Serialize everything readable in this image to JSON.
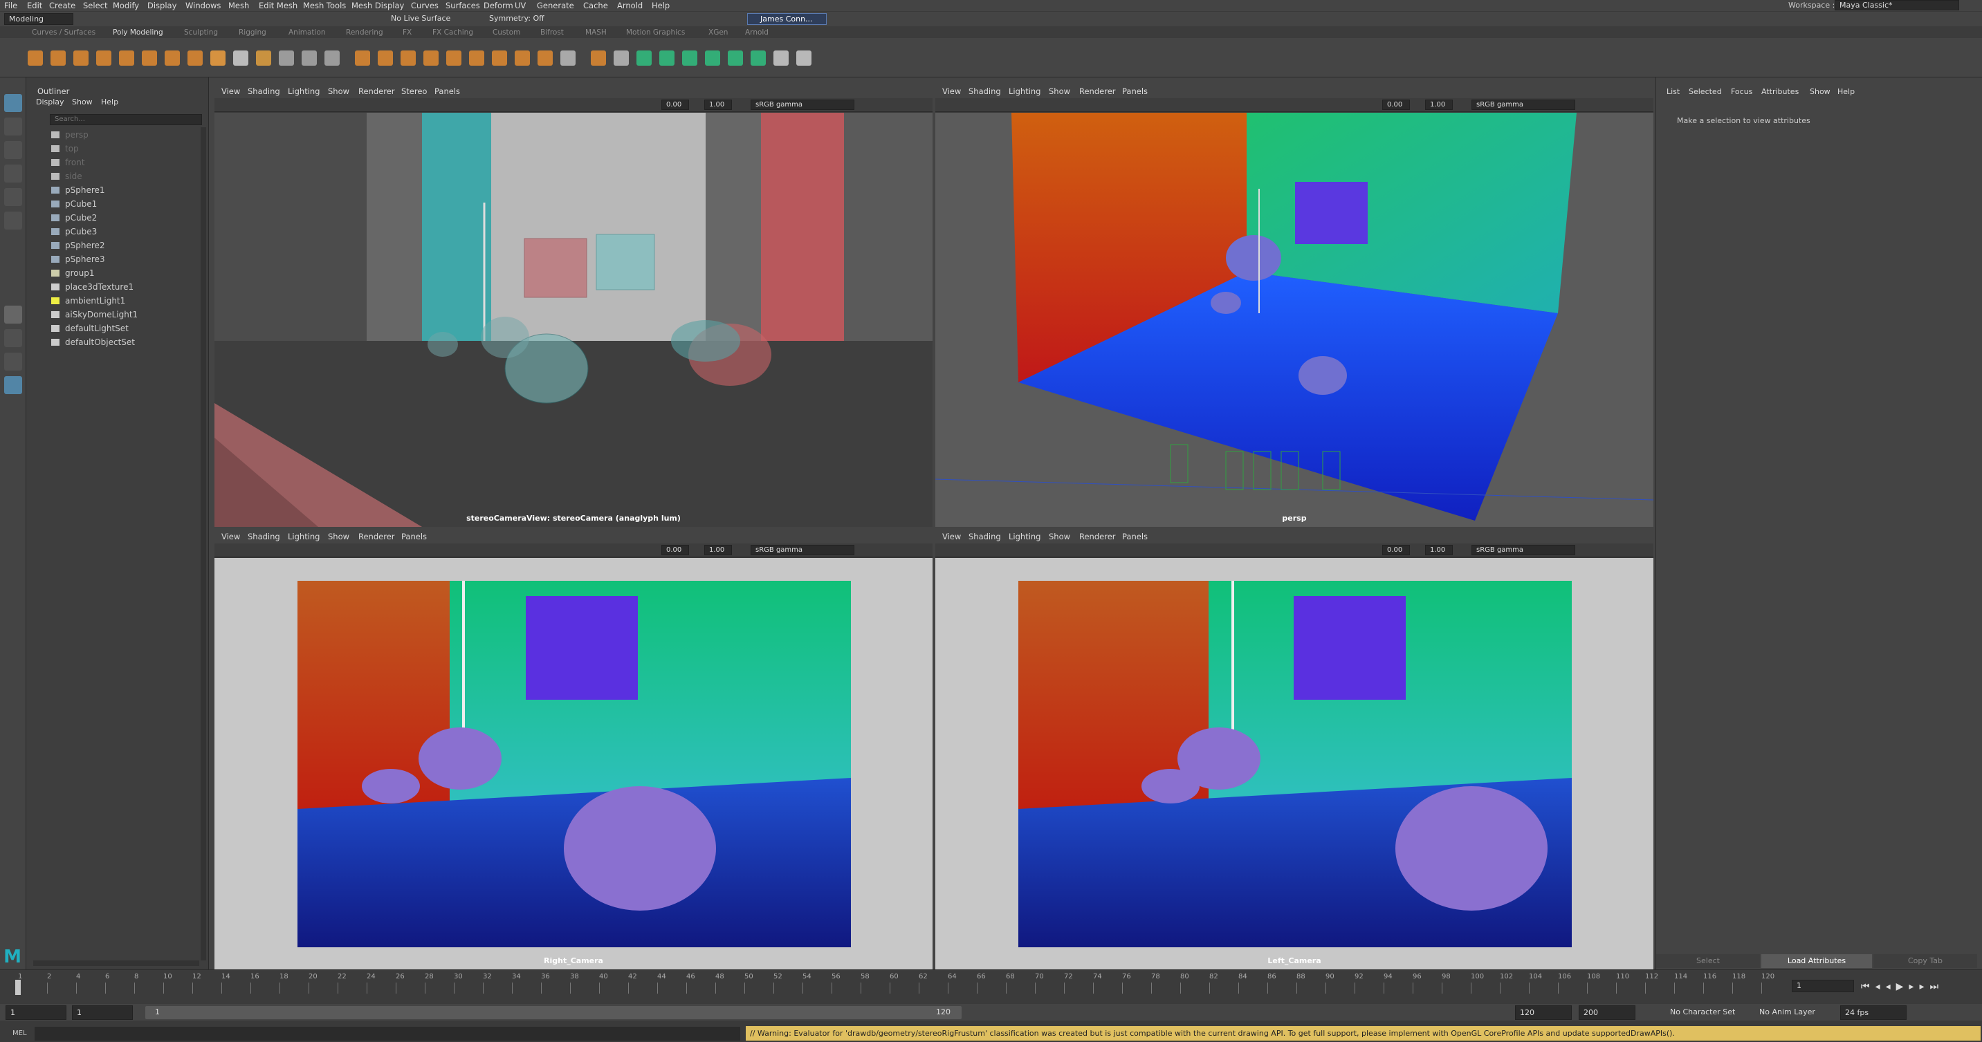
{
  "menubar": {
    "items": [
      "File",
      "Edit",
      "Create",
      "Select",
      "Modify",
      "Display",
      "Windows",
      "Mesh",
      "Edit Mesh",
      "Mesh Tools",
      "Mesh Display",
      "Curves",
      "Surfaces",
      "Deform",
      "UV",
      "Generate",
      "Cache",
      "Arnold",
      "Help"
    ],
    "workspace_label": "Workspace :",
    "workspace_value": "Maya Classic*"
  },
  "status_line": {
    "mode": "Modeling",
    "live_surface": "No Live Surface",
    "symmetry": "Symmetry: Off",
    "user": "James Conn..."
  },
  "shelf_tabs": [
    "Curves / Surfaces",
    "Poly Modeling",
    "Sculpting",
    "Rigging",
    "Animation",
    "Rendering",
    "FX",
    "FX Caching",
    "Custom",
    "Bifrost",
    "MASH",
    "Motion Graphics",
    "XGen",
    "Arnold"
  ],
  "active_shelf_tab": "Poly Modeling",
  "outliner": {
    "title": "Outliner",
    "menu": [
      "Display",
      "Show",
      "Help"
    ],
    "search_placeholder": "Search...",
    "items": [
      {
        "label": "persp",
        "dim": true,
        "icon": "camera-icon"
      },
      {
        "label": "top",
        "dim": true,
        "icon": "camera-icon"
      },
      {
        "label": "front",
        "dim": true,
        "icon": "camera-icon"
      },
      {
        "label": "side",
        "dim": true,
        "icon": "camera-icon"
      },
      {
        "label": "pSphere1",
        "dim": false,
        "icon": "mesh-icon"
      },
      {
        "label": "pCube1",
        "dim": false,
        "icon": "mesh-icon"
      },
      {
        "label": "pCube2",
        "dim": false,
        "icon": "mesh-icon"
      },
      {
        "label": "pCube3",
        "dim": false,
        "icon": "mesh-icon"
      },
      {
        "label": "pSphere2",
        "dim": false,
        "icon": "mesh-icon"
      },
      {
        "label": "pSphere3",
        "dim": false,
        "icon": "mesh-icon"
      },
      {
        "label": "group1",
        "dim": false,
        "icon": "group-icon"
      },
      {
        "label": "place3dTexture1",
        "dim": false,
        "icon": "texture-icon"
      },
      {
        "label": "ambientLight1",
        "dim": false,
        "icon": "light-icon"
      },
      {
        "label": "aiSkyDomeLight1",
        "dim": false,
        "icon": "skydome-icon"
      },
      {
        "label": "defaultLightSet",
        "dim": false,
        "icon": "set-icon"
      },
      {
        "label": "defaultObjectSet",
        "dim": false,
        "icon": "set-icon"
      }
    ]
  },
  "viewports": {
    "menus_stereo": [
      "View",
      "Shading",
      "Lighting",
      "Show",
      "Renderer",
      "Stereo",
      "Panels"
    ],
    "menus_basic": [
      "View",
      "Shading",
      "Lighting",
      "Show",
      "Renderer",
      "Panels"
    ],
    "exposure": "0.00",
    "gamma": "1.00",
    "colorspace": "sRGB gamma",
    "labels": {
      "tl": "stereoCameraView: stereoCamera (anaglyph lum)",
      "tr": "persp",
      "bl": "Right_Camera",
      "br": "Left_Camera"
    }
  },
  "attribute_editor": {
    "tabs": [
      "List",
      "Selected",
      "Focus",
      "Attributes",
      "Show",
      "Help"
    ],
    "message": "Make a selection to view attributes",
    "buttons": [
      "Select",
      "Load Attributes",
      "Copy Tab"
    ]
  },
  "timeline": {
    "ticks": [
      "1",
      "2",
      "4",
      "6",
      "8",
      "10",
      "12",
      "14",
      "16",
      "18",
      "20",
      "22",
      "24",
      "26",
      "28",
      "30",
      "32",
      "34",
      "36",
      "38",
      "40",
      "42",
      "44",
      "46",
      "48",
      "50",
      "52",
      "54",
      "56",
      "58",
      "60",
      "62",
      "64",
      "66",
      "68",
      "70",
      "72",
      "74",
      "76",
      "78",
      "80",
      "82",
      "84",
      "86",
      "88",
      "90",
      "92",
      "94",
      "96",
      "98",
      "100",
      "102",
      "104",
      "106",
      "108",
      "110",
      "112",
      "114",
      "116",
      "118",
      "120"
    ],
    "current_frame": "1"
  },
  "range": {
    "start": "1",
    "inner_start": "1",
    "slider_start": "1",
    "slider_end": "120",
    "inner_end": "120",
    "end": "200",
    "character_set": "No Character Set",
    "anim_layer": "No Anim Layer",
    "fps": "24 fps"
  },
  "command": {
    "lang": "MEL",
    "warning": "// Warning: Evaluator for 'drawdb/geometry/stereoRigFrustum' classification was created but is just compatible with the current drawing API. To get full support, please implement with OpenGL CoreProfile APIs and update supportedDrawAPIs()."
  }
}
